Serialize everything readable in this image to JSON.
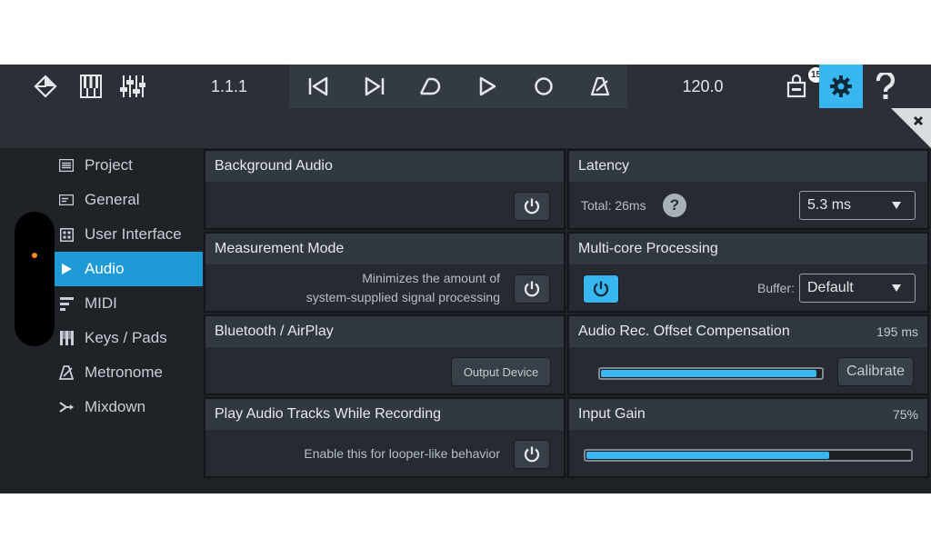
{
  "toolbar": {
    "position": "1.1.1",
    "tempo": "120.0",
    "badge_count": "15",
    "accent_color": "#38b6f0",
    "icons": [
      "cube-icon",
      "keyboard-icon",
      "mixer-icon",
      "skip-back-icon",
      "skip-forward-icon",
      "loop-icon",
      "play-icon",
      "record-icon",
      "metronome-icon",
      "shop-bag-icon",
      "gear-icon",
      "help-icon"
    ]
  },
  "sidebar": {
    "items": [
      {
        "label": "Project",
        "icon": "project-icon"
      },
      {
        "label": "General",
        "icon": "general-icon"
      },
      {
        "label": "User Interface",
        "icon": "ui-grid-icon"
      },
      {
        "label": "Audio",
        "icon": "play-triangle-icon",
        "active": true
      },
      {
        "label": "MIDI",
        "icon": "midi-icon"
      },
      {
        "label": "Keys / Pads",
        "icon": "keys-icon"
      },
      {
        "label": "Metronome",
        "icon": "metronome-icon"
      },
      {
        "label": "Mixdown",
        "icon": "mixdown-icon"
      }
    ]
  },
  "panels": {
    "background_audio": {
      "title": "Background Audio"
    },
    "measurement_mode": {
      "title": "Measurement Mode",
      "desc_line1": "Minimizes the amount of",
      "desc_line2": "system-supplied signal processing"
    },
    "bluetooth": {
      "title": "Bluetooth / AirPlay",
      "button": "Output Device"
    },
    "play_tracks": {
      "title": "Play Audio Tracks While Recording",
      "desc": "Enable this for looper-like behavior"
    },
    "latency": {
      "title": "Latency",
      "total": "Total: 26ms",
      "select": "5.3 ms"
    },
    "multicore": {
      "title": "Multi-core Processing",
      "buffer_label": "Buffer:",
      "buffer_select": "Default",
      "enabled": true
    },
    "offset": {
      "title": "Audio Rec. Offset Compensation",
      "value": "195 ms",
      "button": "Calibrate",
      "fill_fraction": 0.98
    },
    "input_gain": {
      "title": "Input Gain",
      "value": "75%",
      "fill_fraction": 0.75
    }
  }
}
